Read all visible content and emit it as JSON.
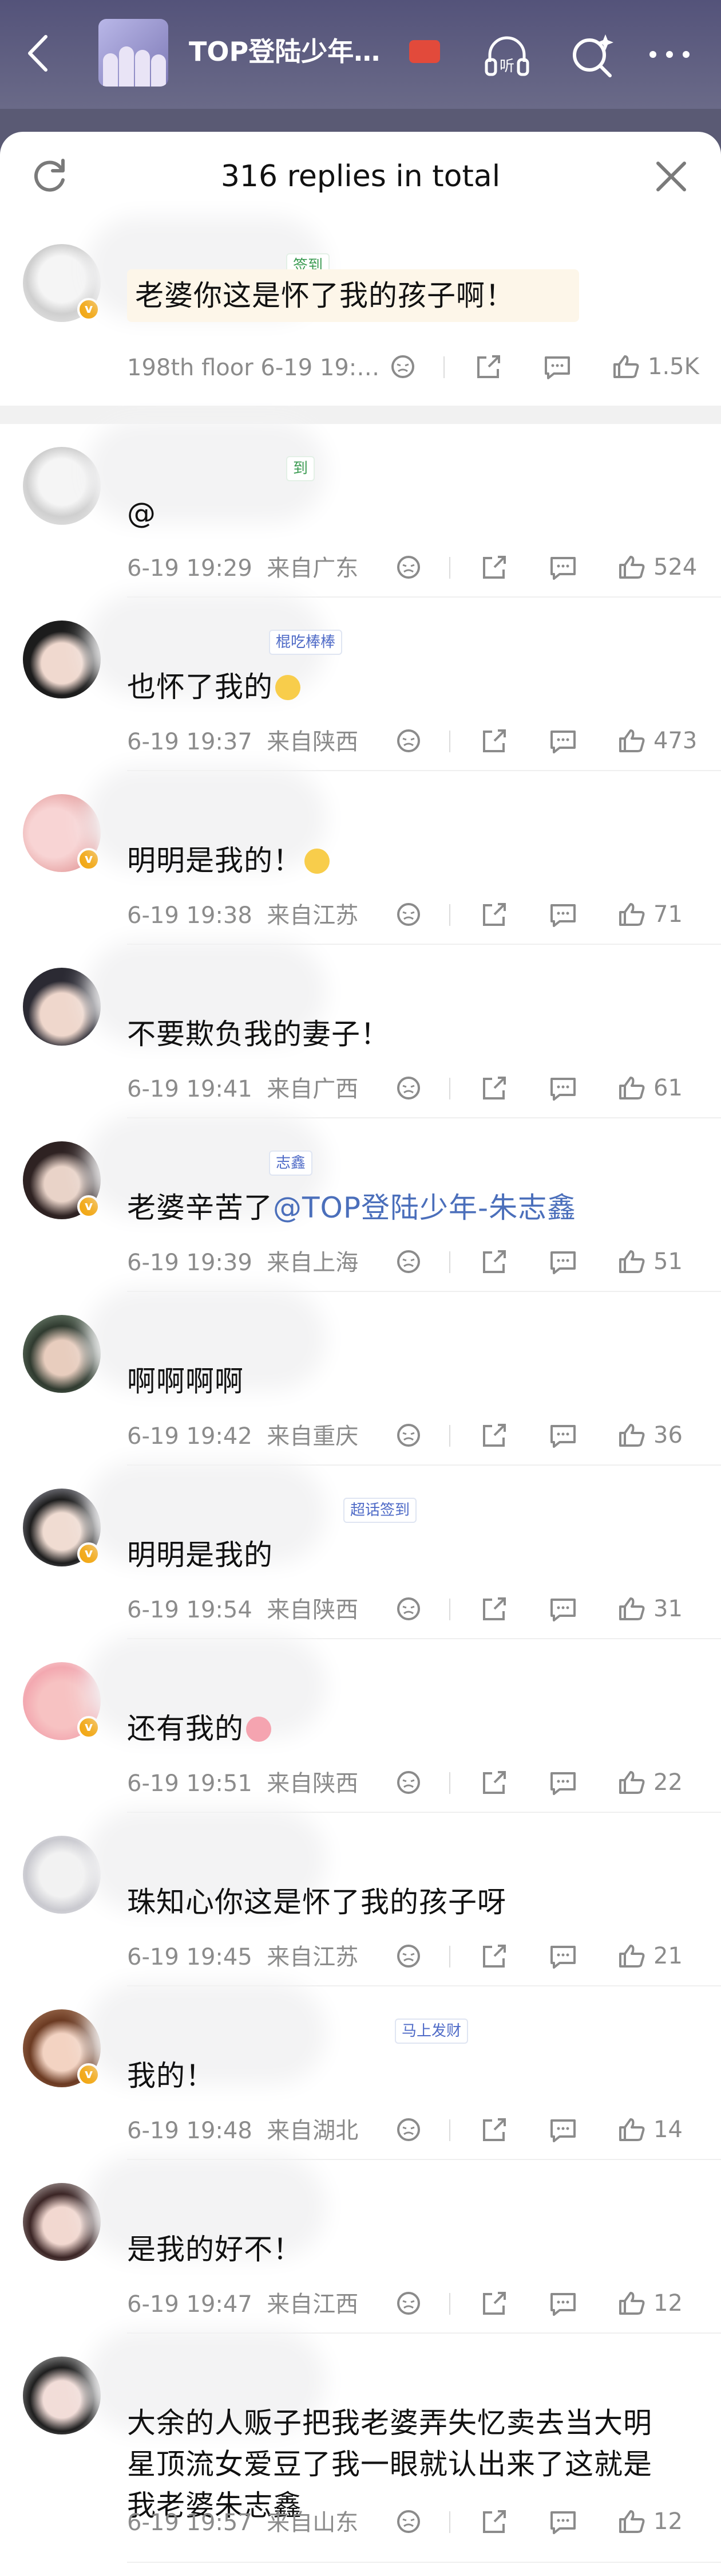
{
  "header": {
    "title": "TOP登陆少年…",
    "badge": "",
    "colors": {
      "bar": "#5b5a7e",
      "accent": "#f2a712",
      "link": "#4b6fbb"
    },
    "icons": [
      "back-arrow-icon",
      "headphone-listen-icon",
      "ai-search-icon",
      "more-dots-icon"
    ],
    "listen_label": "听"
  },
  "sheet": {
    "title": "316 replies in total",
    "icons": [
      "refresh-icon",
      "close-icon"
    ]
  },
  "root_comment": {
    "tag": "签到",
    "text": "老婆你这是怀了我的孩子啊！",
    "meta": "198th floor  6-19 19:…",
    "likes": "1.5K"
  },
  "replies": [
    {
      "tag": "到",
      "text": "@",
      "time": "6-19 19:29",
      "loc": "来自广东",
      "likes": "524"
    },
    {
      "tag": "棍吃棒棒",
      "text": "也怀了我的",
      "emoji": "face",
      "time": "6-19 19:37",
      "loc": "来自陕西",
      "likes": "473"
    },
    {
      "tag": "",
      "text": "明明是我的！",
      "emoji": "face",
      "time": "6-19 19:38",
      "loc": "来自江苏",
      "likes": "71"
    },
    {
      "tag": "",
      "text": "不要欺负我的妻子！",
      "time": "6-19 19:41",
      "loc": "来自广西",
      "likes": "61"
    },
    {
      "tag": "志鑫",
      "text": "老婆辛苦了",
      "mention": "@TOP登陆少年-朱志鑫",
      "time": "6-19 19:39",
      "loc": "来自上海",
      "likes": "51"
    },
    {
      "tag": "",
      "text": "啊啊啊啊",
      "time": "6-19 19:42",
      "loc": "来自重庆",
      "likes": "36"
    },
    {
      "tag": "超话签到",
      "text": "明明是我的",
      "time": "6-19 19:54",
      "loc": "来自陕西",
      "likes": "31"
    },
    {
      "tag": "",
      "text": "还有我的",
      "emoji": "love",
      "time": "6-19 19:51",
      "loc": "来自陕西",
      "likes": "22"
    },
    {
      "tag": "",
      "text": "珠知心你这是怀了我的孩子呀",
      "time": "6-19 19:45",
      "loc": "来自江苏",
      "likes": "21"
    },
    {
      "tag": "马上发财",
      "text": "我的！",
      "time": "6-19 19:48",
      "loc": "来自湖北",
      "likes": "14"
    },
    {
      "tag": "",
      "text": "是我的好不！",
      "time": "6-19 19:47",
      "loc": "来自江西",
      "likes": "12"
    },
    {
      "tag": "",
      "text": "大余的人贩子把我老婆弄失忆卖去当大明星顶流女爱豆了我一眼就认出来了这就是我老婆朱志鑫",
      "time": "6-19 19:57",
      "loc": "来自山东",
      "likes": "12"
    }
  ]
}
